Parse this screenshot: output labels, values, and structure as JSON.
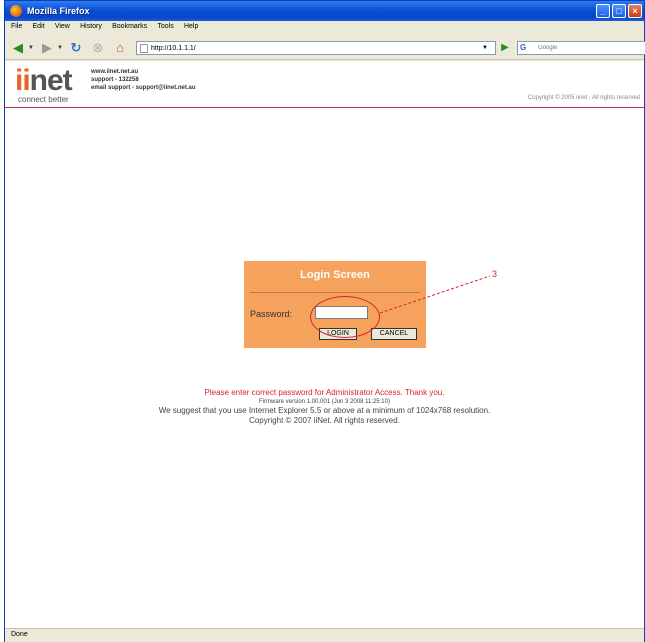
{
  "window": {
    "title": "Mozilla Firefox"
  },
  "menu": {
    "items": [
      "File",
      "Edit",
      "View",
      "History",
      "Bookmarks",
      "Tools",
      "Help"
    ]
  },
  "nav": {
    "url": "http://10.1.1.1/",
    "search_placeholder": "Google",
    "search_engine_icon": "G"
  },
  "header": {
    "logo_word_accent": "ii",
    "logo_word_rest": "net",
    "logo_tagline": "connect better",
    "contact_lines": [
      "www.iinet.net.au",
      "support - 132258",
      "email support - support@iinet.net.au"
    ],
    "copyright": "Copyright © 2005 iinet . All rights reserved"
  },
  "login": {
    "title": "Login Screen",
    "password_label": "Password:",
    "login_button": "LOGIN",
    "cancel_button": "CANCEL"
  },
  "annotation": {
    "number": "3",
    "color": "#d9232a"
  },
  "messages": {
    "red": "Please enter correct password for Administrator Access. Thank you.",
    "firmware": "Firmware version 1.00.001 (Jun 3 2008 11:25:10)",
    "suggest": "We suggest that you use Internet Explorer 5.5 or above at a minimum of 1024x768 resolution.",
    "copyright": "Copyright © 2007 iiNet. All rights reserved."
  },
  "status": {
    "text": "Done"
  },
  "colors": {
    "panel": "#f5a25d",
    "brand_orange": "#e8642b",
    "divider_red": "#cc3344"
  }
}
